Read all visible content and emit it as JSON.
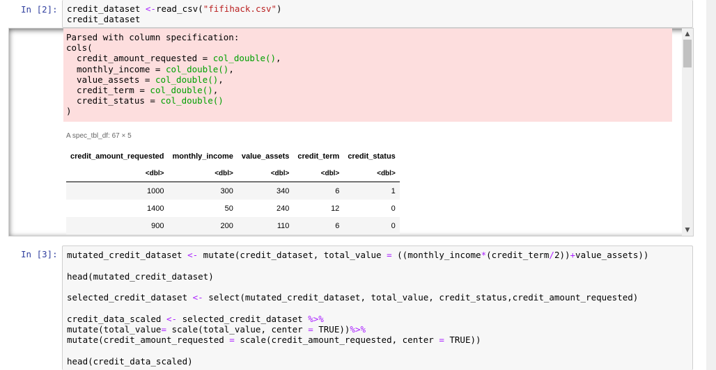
{
  "cell2": {
    "prompt": "In [2]:",
    "code": [
      [
        {
          "t": "credit_dataset "
        },
        {
          "t": "<-",
          "c": "op"
        },
        {
          "t": "read_csv("
        },
        {
          "t": "\"fifihack.csv\"",
          "c": "str"
        },
        {
          "t": ")"
        }
      ],
      [
        {
          "t": "credit_dataset"
        }
      ]
    ]
  },
  "stderr": {
    "lines": [
      [
        {
          "t": "Parsed with column specification:"
        }
      ],
      [
        {
          "t": "cols("
        }
      ],
      [
        {
          "t": "  credit_amount_requested = "
        },
        {
          "t": "col_double()",
          "c": "grn"
        },
        {
          "t": ","
        }
      ],
      [
        {
          "t": "  monthly_income = "
        },
        {
          "t": "col_double()",
          "c": "grn"
        },
        {
          "t": ","
        }
      ],
      [
        {
          "t": "  value_assets = "
        },
        {
          "t": "col_double()",
          "c": "grn"
        },
        {
          "t": ","
        }
      ],
      [
        {
          "t": "  credit_term = "
        },
        {
          "t": "col_double()",
          "c": "grn"
        },
        {
          "t": ","
        }
      ],
      [
        {
          "t": "  credit_status = "
        },
        {
          "t": "col_double()",
          "c": "grn"
        }
      ],
      [
        {
          "t": ")"
        }
      ]
    ]
  },
  "table": {
    "caption": "A spec_tbl_df: 67 × 5",
    "columns": [
      "credit_amount_requested",
      "monthly_income",
      "value_assets",
      "credit_term",
      "credit_status"
    ],
    "types": [
      "<dbl>",
      "<dbl>",
      "<dbl>",
      "<dbl>",
      "<dbl>"
    ],
    "rows": [
      [
        "1000",
        "300",
        "340",
        "6",
        "1"
      ],
      [
        "1400",
        "50",
        "240",
        "12",
        "0"
      ],
      [
        "900",
        "200",
        "110",
        "6",
        "0"
      ]
    ]
  },
  "cell3": {
    "prompt": "In [3]:",
    "code": [
      [
        {
          "t": "mutated_credit_dataset "
        },
        {
          "t": "<-",
          "c": "op"
        },
        {
          "t": " mutate(credit_dataset, total_value "
        },
        {
          "t": "=",
          "c": "op"
        },
        {
          "t": " ((monthly_income"
        },
        {
          "t": "*",
          "c": "op"
        },
        {
          "t": "(credit_term"
        },
        {
          "t": "/",
          "c": "op"
        },
        {
          "t": "2))"
        },
        {
          "t": "+",
          "c": "op"
        },
        {
          "t": "value_assets))"
        }
      ],
      [
        {
          "t": ""
        }
      ],
      [
        {
          "t": "head(mutated_credit_dataset)"
        }
      ],
      [
        {
          "t": ""
        }
      ],
      [
        {
          "t": "selected_credit_dataset "
        },
        {
          "t": "<-",
          "c": "op"
        },
        {
          "t": " select(mutated_credit_dataset, total_value, credit_status,credit_amount_requested)"
        }
      ],
      [
        {
          "t": ""
        }
      ],
      [
        {
          "t": "credit_data_scaled "
        },
        {
          "t": "<-",
          "c": "op"
        },
        {
          "t": " selected_credit_dataset "
        },
        {
          "t": "%>%",
          "c": "op"
        }
      ],
      [
        {
          "t": "mutate(total_value"
        },
        {
          "t": "=",
          "c": "op"
        },
        {
          "t": " scale(total_value, center "
        },
        {
          "t": "=",
          "c": "op"
        },
        {
          "t": " TRUE))"
        },
        {
          "t": "%>%",
          "c": "op"
        }
      ],
      [
        {
          "t": "mutate(credit_amount_requested "
        },
        {
          "t": "=",
          "c": "op"
        },
        {
          "t": " scale(credit_amount_requested, center "
        },
        {
          "t": "=",
          "c": "op"
        },
        {
          "t": " TRUE))"
        }
      ],
      [
        {
          "t": ""
        }
      ],
      [
        {
          "t": "head(credit_data_scaled)"
        }
      ]
    ]
  },
  "scrollbar": {
    "up_icon": "▲",
    "down_icon": "▼"
  }
}
